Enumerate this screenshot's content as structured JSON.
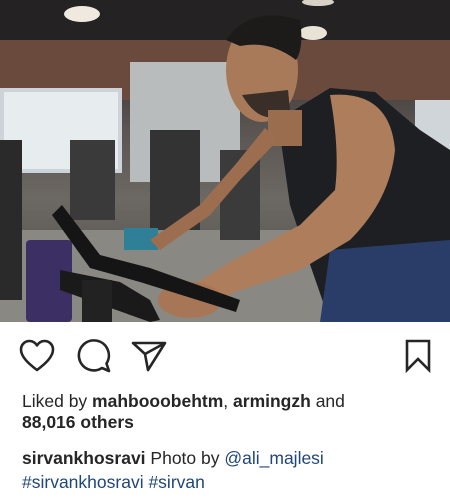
{
  "post": {
    "photo_alt": "",
    "actions": {
      "like_icon": "heart-outline",
      "comment_icon": "speech-bubble-outline",
      "share_icon": "paper-plane-outline",
      "save_icon": "bookmark-outline"
    },
    "likes": {
      "prefix": "Liked by ",
      "user1": "mahbooobehtm",
      "separator": ", ",
      "user2": "armingzh",
      "conj": " and",
      "count": "88,016 others"
    },
    "caption": {
      "author": "sirvankhosravi",
      "text": " Photo by ",
      "mention": "@ali_majlesi",
      "hashtag1": "#sirvankhosravi",
      "hashtag2": "#sirvan"
    },
    "colors": {
      "text": "#262626",
      "link": "#20467a",
      "background": "#ffffff"
    }
  }
}
